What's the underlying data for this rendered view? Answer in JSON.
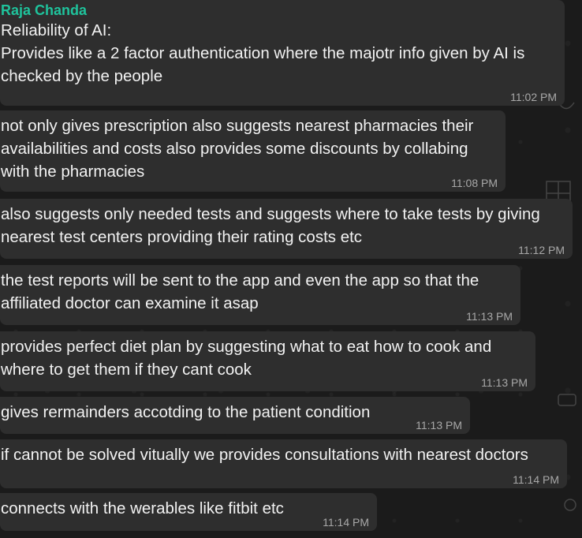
{
  "messages": [
    {
      "sender": "Raja Chanda",
      "text": "Reliability of AI:\nProvides like a 2 factor authentication where the majotr info given by AI is checked by the people",
      "time": "11:02 PM"
    },
    {
      "text": "not only gives prescription also suggests nearest pharmacies their availabilities and costs also provides some discounts by collabing with the pharmacies",
      "time": "11:08 PM"
    },
    {
      "text": "also suggests only needed tests and suggests where to take tests by giving nearest test centers providing their rating costs etc",
      "time": "11:12 PM"
    },
    {
      "text": "the test reports will be sent to the app and even the app so that the affiliated doctor can examine it asap",
      "time": "11:13 PM"
    },
    {
      "text": "provides perfect diet plan by suggesting what to eat how to cook and where to get them if they cant cook",
      "time": "11:13 PM"
    },
    {
      "text": "gives rermainders accotding to the patient condition",
      "time": "11:13 PM"
    },
    {
      "text": "if cannot be solved vitually we provides consultations with nearest doctors",
      "time": "11:14 PM"
    },
    {
      "text": "connects with the werables like fitbit etc",
      "time": "11:14 PM"
    }
  ]
}
